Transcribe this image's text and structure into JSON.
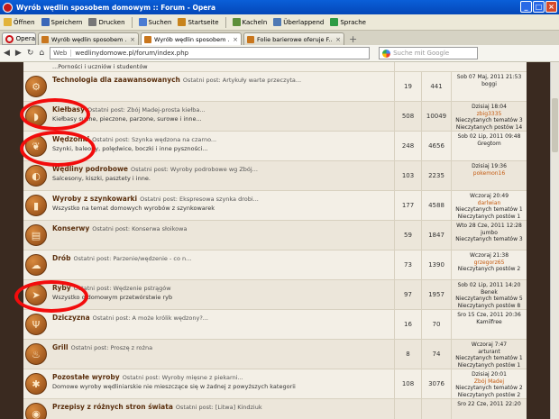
{
  "window": {
    "title": "Wyrób wędlin sposobem domowym :: Forum - Opera",
    "minimize": "_",
    "maximize": "□",
    "close": "×"
  },
  "toolbar": {
    "items": [
      {
        "label": "Öffnen",
        "icon": "folder-icon",
        "color": "#e2b33a"
      },
      {
        "label": "Speichern",
        "icon": "disk-icon",
        "color": "#3b67b8"
      },
      {
        "label": "Drucken",
        "icon": "printer-icon",
        "color": "#777777"
      },
      {
        "label": "Suchen",
        "icon": "search-icon",
        "color": "#4a7bd2"
      },
      {
        "label": "Startseite",
        "icon": "home-icon",
        "color": "#c8841c"
      },
      {
        "label": "Kacheln",
        "icon": "tiles-icon",
        "color": "#5d8f3a"
      },
      {
        "label": "Überlappend",
        "icon": "cascade-icon",
        "color": "#4e79b4"
      },
      {
        "label": "Sprache",
        "icon": "speech-icon",
        "color": "#2e9c45"
      }
    ]
  },
  "tabs": {
    "opera_label": "Opera",
    "items": [
      {
        "label": "Wyrób wędlin sposobem ...",
        "active": false
      },
      {
        "label": "Wyrób wędlin sposobem ...",
        "active": true
      },
      {
        "label": "Folie barierowe oferuje F...",
        "active": false
      }
    ],
    "close_glyph": "×",
    "new_tab": "+"
  },
  "address": {
    "web_label": "Web",
    "url": "wedlinydomowe.pl/forum/index.php",
    "search_placeholder": "Suche mit Google"
  },
  "forum": {
    "partial_top_text": "...Porności i uczniów i studentów",
    "last_prefix": "Ostatni post:",
    "rows": [
      {
        "name": "Technologia dla zaawansowanych",
        "last_post": "Artykuły warte przeczyta...",
        "desc": "",
        "topics": "19",
        "posts": "441",
        "last_lines": [
          {
            "t": "Sob 07 Maj, 2011 21:53",
            "cls": ""
          },
          {
            "t": "boggi",
            "cls": ""
          }
        ],
        "icon": "gears-icon",
        "glyph": "⚙"
      },
      {
        "name": "Kiełbasy",
        "last_post": "Zbój Madej-prosta kiełba...",
        "desc": "Kiełbasy suche, pieczone, parzone, surowe i inne...",
        "topics": "508",
        "posts": "10049",
        "last_lines": [
          {
            "t": "Dzisiaj 18:04",
            "cls": ""
          },
          {
            "t": "zbig3335",
            "cls": "author alt2"
          },
          {
            "t": "Nieczytanych tematów 3",
            "cls": "unread"
          },
          {
            "t": "Nieczytanych postów 14",
            "cls": "unread"
          }
        ],
        "icon": "sausage-icon",
        "glyph": "◗"
      },
      {
        "name": "Wędzonki",
        "last_post": "Szynka wędzona na czarno...",
        "desc": "Szynki, baleony, polędwice, boczki i inne pyszności...",
        "topics": "248",
        "posts": "4656",
        "last_lines": [
          {
            "t": "Sob 02 Lip, 2011 09:48",
            "cls": ""
          },
          {
            "t": "Gregtom",
            "cls": ""
          }
        ],
        "icon": "ham-icon",
        "glyph": "❦"
      },
      {
        "name": "Wędliny podrobowe",
        "last_post": "Wyroby podrobowe wg Zbój...",
        "desc": "Salcesony, kiszki, pasztety i inne.",
        "topics": "103",
        "posts": "2235",
        "last_lines": [
          {
            "t": "Dzisiaj 19:36",
            "cls": ""
          },
          {
            "t": "pokemon16",
            "cls": "author alt2"
          }
        ],
        "icon": "offal-icon",
        "glyph": "◐"
      },
      {
        "name": "Wyroby z szynkowarki",
        "last_post": "Ekspresowa szynka drobi...",
        "desc": "Wszystko na temat domowych wyrobów z szynkowarek",
        "topics": "177",
        "posts": "4588",
        "last_lines": [
          {
            "t": "Wczoraj 20:49",
            "cls": ""
          },
          {
            "t": "darlwian",
            "cls": "author alt2"
          },
          {
            "t": "Nieczytanych tematów 1",
            "cls": "unread"
          },
          {
            "t": "Nieczytanych postów 1",
            "cls": "unread"
          }
        ],
        "icon": "ham-press-icon",
        "glyph": "▮"
      },
      {
        "name": "Konserwy",
        "last_post": "Konserwa słoikowa",
        "desc": "",
        "topics": "59",
        "posts": "1847",
        "last_lines": [
          {
            "t": "Wto 28 Cze, 2011 12:28",
            "cls": ""
          },
          {
            "t": "jumbo",
            "cls": ""
          },
          {
            "t": "Nieczytanych tematów 3",
            "cls": "unread"
          }
        ],
        "icon": "jar-icon",
        "glyph": "▤"
      },
      {
        "name": "Drób",
        "last_post": "Parzenie/wędzenie - co n...",
        "desc": "",
        "topics": "73",
        "posts": "1390",
        "last_lines": [
          {
            "t": "Wczoraj 21:38",
            "cls": ""
          },
          {
            "t": "grzegorz65",
            "cls": "author alt2"
          },
          {
            "t": "Nieczytanych postów 2",
            "cls": "unread"
          }
        ],
        "icon": "poultry-icon",
        "glyph": "☁"
      },
      {
        "name": "Ryby",
        "last_post": "Wędzenie pstrągów",
        "desc": "Wszystko o domowym przetwórstwie ryb",
        "topics": "97",
        "posts": "1957",
        "last_lines": [
          {
            "t": "Sob 02 Lip, 2011 14:20",
            "cls": ""
          },
          {
            "t": "Benek",
            "cls": ""
          },
          {
            "t": "Nieczytanych tematów 5",
            "cls": "unread"
          },
          {
            "t": "Nieczytanych postów 8",
            "cls": "unread"
          }
        ],
        "icon": "fish-icon",
        "glyph": "➤"
      },
      {
        "name": "Dziczyzna",
        "last_post": "A może królik wędzony?...",
        "desc": "",
        "topics": "16",
        "posts": "70",
        "last_lines": [
          {
            "t": "Sro 15 Cze, 2011 20:36",
            "cls": ""
          },
          {
            "t": "Kamilfree",
            "cls": ""
          }
        ],
        "icon": "deer-icon",
        "glyph": "Ψ"
      },
      {
        "name": "Grill",
        "last_post": "Proszę z rożna",
        "desc": "",
        "topics": "8",
        "posts": "74",
        "last_lines": [
          {
            "t": "Wczoraj 7:47",
            "cls": ""
          },
          {
            "t": "arturant",
            "cls": ""
          },
          {
            "t": "Nieczytanych tematów 1",
            "cls": "unread"
          },
          {
            "t": "Nieczytanych postów 1",
            "cls": "unread"
          }
        ],
        "icon": "grill-icon",
        "glyph": "♨"
      },
      {
        "name": "Pozostałe wyroby",
        "last_post": "Wyroby mięsne z piekarni...",
        "desc": "Domowe wyroby wędliniarskie nie mieszczące się w żadnej z powyższych kategorii",
        "topics": "108",
        "posts": "3076",
        "last_lines": [
          {
            "t": "Dzisiaj 20:01",
            "cls": ""
          },
          {
            "t": "Zbój Madej",
            "cls": "author alt2"
          },
          {
            "t": "Nieczytanych tematów 2",
            "cls": "unread"
          },
          {
            "t": "Nieczytanych postów 2",
            "cls": "unread"
          }
        ],
        "icon": "misc-icon",
        "glyph": "✱"
      },
      {
        "name": "Przepisy z różnych stron świata",
        "last_post": "[Litwa] Kindziuk",
        "desc": "",
        "topics": "",
        "posts": "",
        "last_lines": [
          {
            "t": "Sro 22 Cze, 2011 22:20",
            "cls": ""
          }
        ],
        "icon": "globe-icon",
        "glyph": "◉"
      }
    ]
  }
}
